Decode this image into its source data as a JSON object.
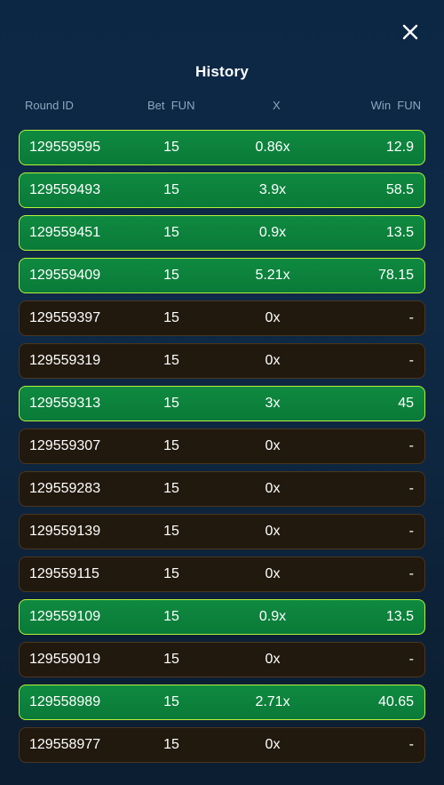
{
  "title": "History",
  "columns": {
    "round_id": "Round ID",
    "bet": "Bet  FUN",
    "x": "X",
    "win": "Win  FUN"
  },
  "rows": [
    {
      "id": "129559595",
      "bet": "15",
      "x": "0.86x",
      "win": "12.9",
      "status": "win"
    },
    {
      "id": "129559493",
      "bet": "15",
      "x": "3.9x",
      "win": "58.5",
      "status": "win"
    },
    {
      "id": "129559451",
      "bet": "15",
      "x": "0.9x",
      "win": "13.5",
      "status": "win"
    },
    {
      "id": "129559409",
      "bet": "15",
      "x": "5.21x",
      "win": "78.15",
      "status": "win"
    },
    {
      "id": "129559397",
      "bet": "15",
      "x": "0x",
      "win": "-",
      "status": "loss"
    },
    {
      "id": "129559319",
      "bet": "15",
      "x": "0x",
      "win": "-",
      "status": "loss"
    },
    {
      "id": "129559313",
      "bet": "15",
      "x": "3x",
      "win": "45",
      "status": "win"
    },
    {
      "id": "129559307",
      "bet": "15",
      "x": "0x",
      "win": "-",
      "status": "loss"
    },
    {
      "id": "129559283",
      "bet": "15",
      "x": "0x",
      "win": "-",
      "status": "loss"
    },
    {
      "id": "129559139",
      "bet": "15",
      "x": "0x",
      "win": "-",
      "status": "loss"
    },
    {
      "id": "129559115",
      "bet": "15",
      "x": "0x",
      "win": "-",
      "status": "loss"
    },
    {
      "id": "129559109",
      "bet": "15",
      "x": "0.9x",
      "win": "13.5",
      "status": "win"
    },
    {
      "id": "129559019",
      "bet": "15",
      "x": "0x",
      "win": "-",
      "status": "loss"
    },
    {
      "id": "129558989",
      "bet": "15",
      "x": "2.71x",
      "win": "40.65",
      "status": "win"
    },
    {
      "id": "129558977",
      "bet": "15",
      "x": "0x",
      "win": "-",
      "status": "loss"
    }
  ],
  "icons": {
    "close": "close-icon"
  },
  "colors": {
    "win_bg": "#0f8a40",
    "win_border": "#b7f23a",
    "loss_bg": "#22190e",
    "loss_border": "#4a3620",
    "header_text": "#8ea6bf"
  }
}
